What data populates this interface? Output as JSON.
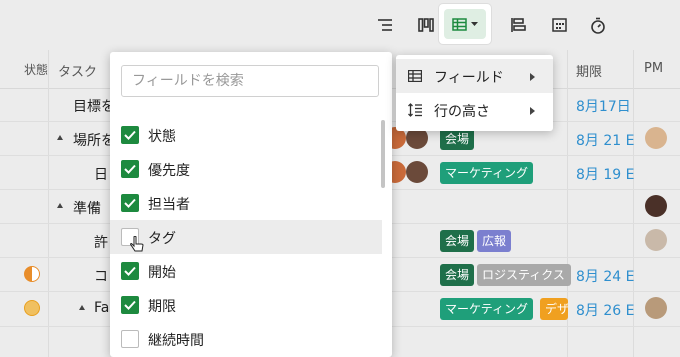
{
  "columns": {
    "status": "状態",
    "task": "タスク",
    "due": "期限",
    "pm": "PM"
  },
  "rows": [
    {
      "task": "目標を",
      "due": "8月17日"
    },
    {
      "task": "場所を",
      "tags": [
        "会場"
      ],
      "due": "8月 21 E"
    },
    {
      "task": "日",
      "tags": [
        "マーケティング"
      ],
      "due": "8月 19 E"
    },
    {
      "task": "準備"
    },
    {
      "task": "許",
      "tags": [
        "会場",
        "広報"
      ]
    },
    {
      "task": "コ",
      "tags": [
        "会場",
        "ロジスティクス"
      ],
      "due": "8月 24 E"
    },
    {
      "task": "Fa",
      "tags": [
        "マーケティング",
        "デザ"
      ],
      "due": "8月 26 E"
    }
  ],
  "colors": {
    "venue": "#1f6f4a",
    "marketing": "#1f9f7a",
    "pr": "#7b7fcf",
    "logistics": "#a9a9a9",
    "design": "#f0a020",
    "check": "#1d8a3f",
    "date": "#2f8fce"
  },
  "field_menu": {
    "search_placeholder": "フィールドを検索",
    "items": [
      {
        "label": "状態",
        "checked": true
      },
      {
        "label": "優先度",
        "checked": true
      },
      {
        "label": "担当者",
        "checked": true
      },
      {
        "label": "タグ",
        "checked": false
      },
      {
        "label": "開始",
        "checked": true
      },
      {
        "label": "期限",
        "checked": true
      },
      {
        "label": "継続時間",
        "checked": false
      }
    ]
  },
  "submenu": {
    "items": [
      {
        "label": "フィールド",
        "icon": "table-icon"
      },
      {
        "label": "行の高さ",
        "icon": "row-height-icon"
      }
    ]
  },
  "toolbar": {
    "icons": [
      "list-indent-icon",
      "board-icon",
      "table-view-icon",
      "gantt-icon",
      "calendar-icon",
      "stopwatch-icon"
    ]
  }
}
